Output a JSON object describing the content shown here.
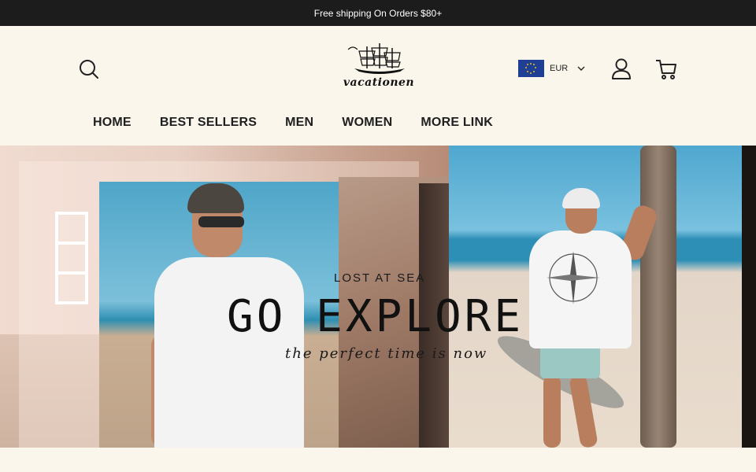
{
  "announcement": {
    "text": "Free shipping On Orders $80+"
  },
  "header": {
    "logo_text": "vacationen",
    "currency": {
      "code": "EUR"
    }
  },
  "nav": {
    "items": [
      {
        "label": "HOME"
      },
      {
        "label": "BEST SELLERS"
      },
      {
        "label": "MEN"
      },
      {
        "label": "WOMEN"
      },
      {
        "label": "MORE LINK"
      }
    ]
  },
  "hero": {
    "eyebrow": "LOST AT SEA",
    "title": "GO EXPLORE",
    "subtitle": "the perfect time is now"
  },
  "colors": {
    "topbar_bg": "#1c1c1c",
    "page_bg": "#fbf6ec",
    "text_dark": "#1f1f1f",
    "flag_blue": "#1f3f96",
    "flag_star": "#f5c400"
  },
  "icons": [
    "search-icon",
    "ship-logo-icon",
    "eu-flag-icon",
    "chevron-down-icon",
    "user-icon",
    "cart-icon"
  ]
}
